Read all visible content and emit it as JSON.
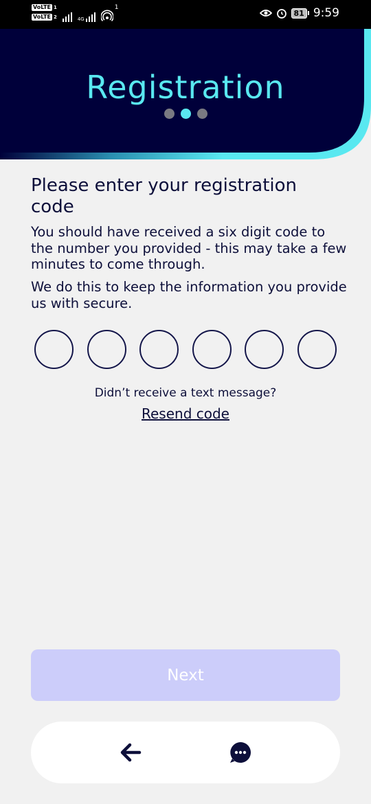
{
  "status_bar": {
    "volte1": "VoLTE",
    "volte1_sim": "1",
    "volte2": "VoLTE",
    "volte2_sim": "2",
    "network_label": "4G",
    "hotspot_count": "1",
    "battery": "81",
    "time": "9:59",
    "icons": [
      "eye-comfort-icon",
      "alarm-icon",
      "battery-icon",
      "signal-icon",
      "hotspot-icon"
    ]
  },
  "header": {
    "title": "Registration",
    "steps_total": 3,
    "active_step": 2
  },
  "content": {
    "heading": "Please enter your registration code",
    "paragraph1": "You should have received a six digit code to the number you provided - this may take a few minutes to come through.",
    "paragraph2": "We do this to keep the information you provide us with secure.",
    "code_digits": [
      "",
      "",
      "",
      "",
      "",
      ""
    ],
    "no_text_prompt": "Didn’t receive a text message?",
    "resend_link": "Resend code"
  },
  "footer": {
    "next_label": "Next",
    "back_icon": "arrow-left-icon",
    "chat_icon": "chat-bubble-icon"
  },
  "colors": {
    "header_bg": "#00003a",
    "accent": "#59e8f0",
    "text": "#0d0f3a",
    "next_disabled": "#cccdfa",
    "page_bg": "#f1f1f1"
  }
}
